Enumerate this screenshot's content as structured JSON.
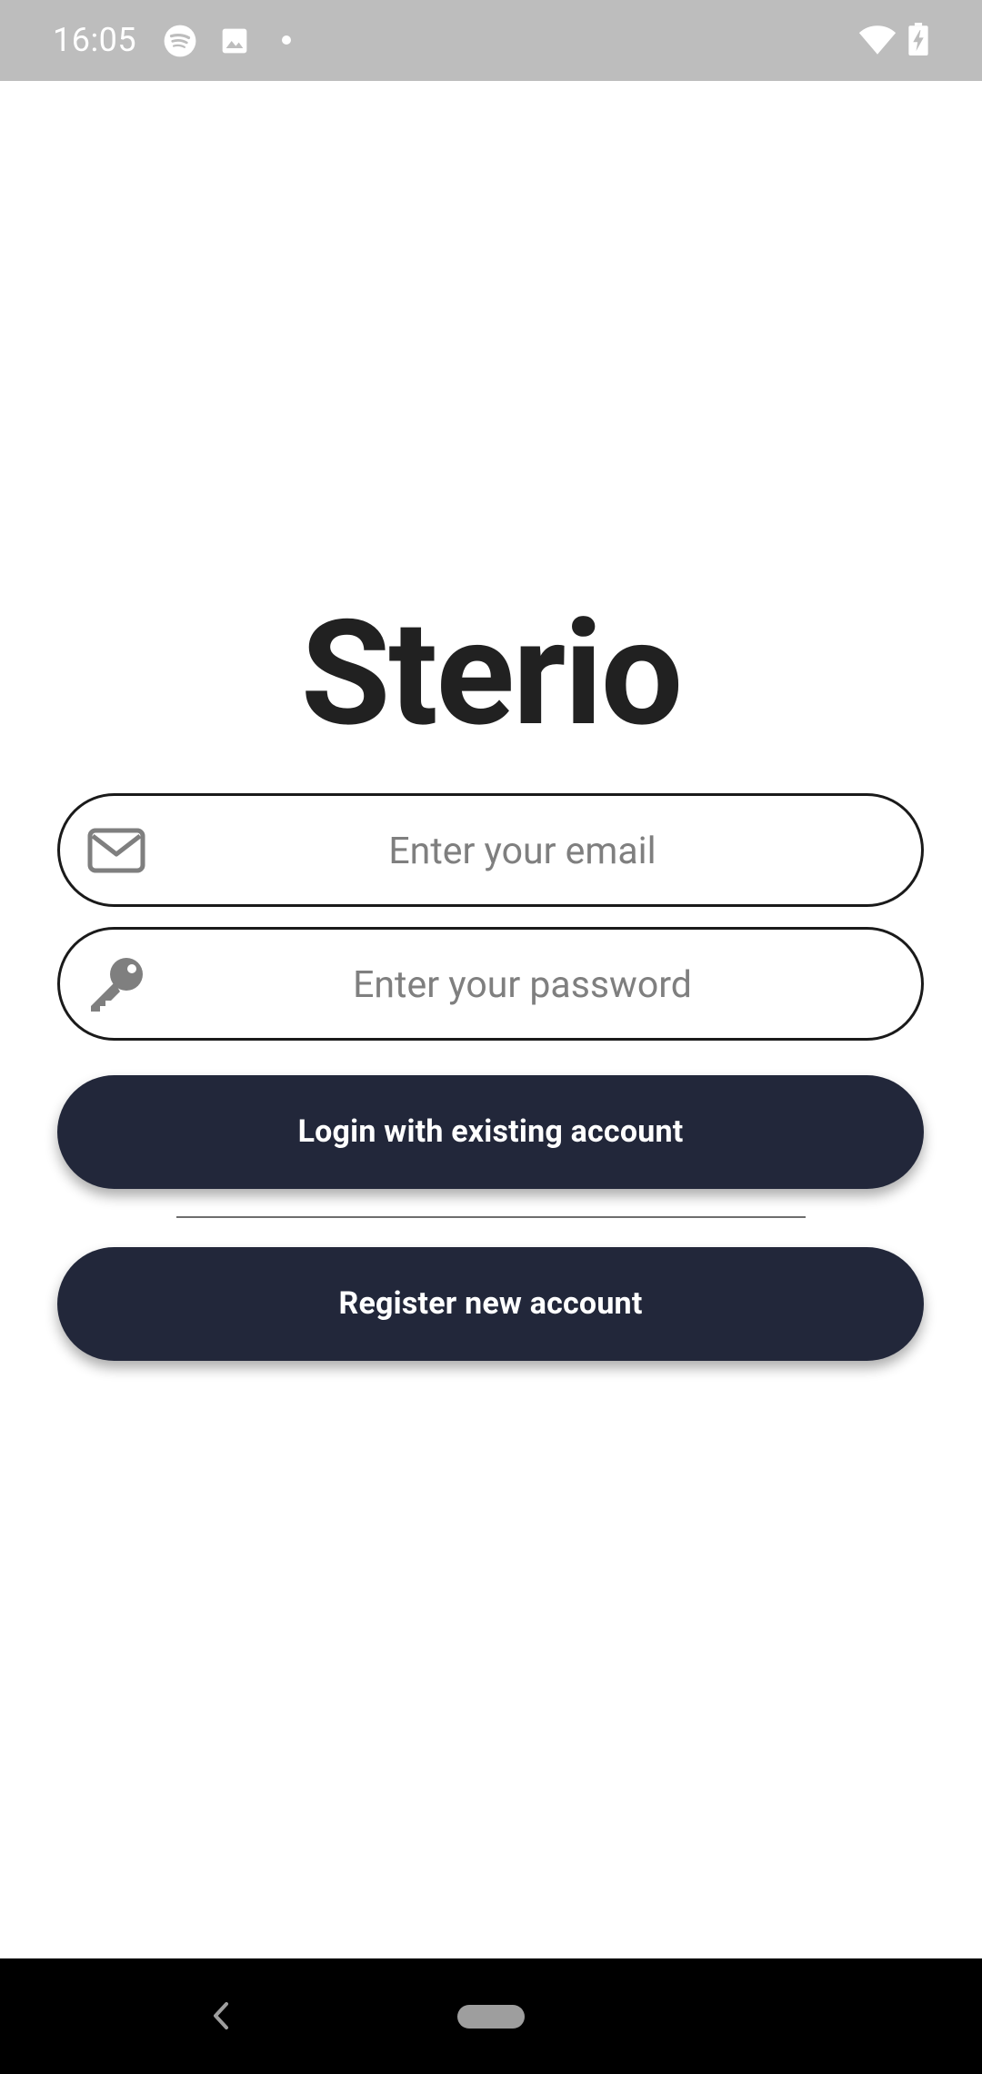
{
  "status_bar": {
    "time": "16:05",
    "icons": [
      "spotify-icon",
      "image-icon",
      "dot-icon",
      "wifi-icon",
      "battery-charging-icon"
    ]
  },
  "app": {
    "title": "Sterio"
  },
  "form": {
    "email_placeholder": "Enter your email",
    "email_icon": "envelope-icon",
    "password_placeholder": "Enter your password",
    "password_icon": "key-icon"
  },
  "buttons": {
    "login_label": "Login with existing account",
    "register_label": "Register new account"
  },
  "colors": {
    "button_background": "#22273a",
    "status_bar": "#bdbdbd",
    "title_text": "#212121",
    "placeholder_text": "#7f7f7f"
  },
  "nav_bar": {
    "icons": [
      "back-icon",
      "home-pill-icon"
    ]
  }
}
